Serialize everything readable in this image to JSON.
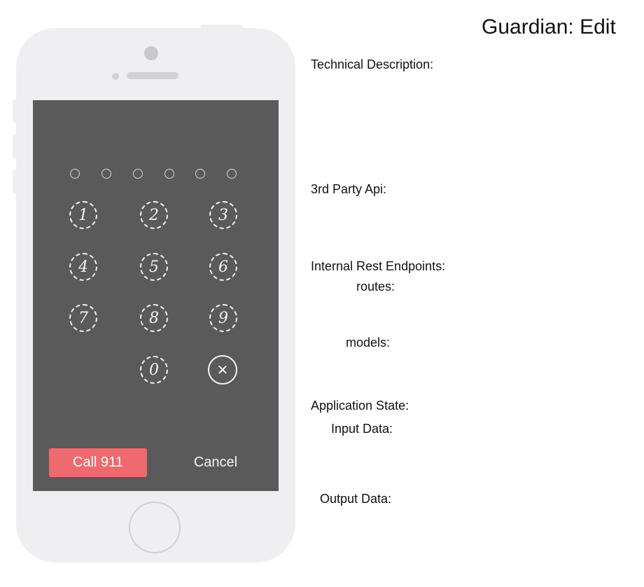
{
  "page": {
    "title": "Guardian: Edit"
  },
  "spec": {
    "technical_description": "Technical Description:",
    "third_party_api": "3rd Party Api:",
    "internal_rest_endpoints": "Internal Rest Endpoints:",
    "routes": "routes:",
    "models": "models:",
    "application_state": "Application State:",
    "input_data": "Input Data:",
    "output_data": "Output Data:"
  },
  "keypad": {
    "keys": [
      "1",
      "2",
      "3",
      "4",
      "5",
      "6",
      "7",
      "8",
      "9",
      "0"
    ],
    "delete_symbol": "✕",
    "pin_length": 6
  },
  "actions": {
    "call_label": "Call 911",
    "cancel_label": "Cancel"
  },
  "colors": {
    "screen": "#5a5a5a",
    "phone_body": "#efeff1",
    "call_button": "#ef6a6e"
  }
}
